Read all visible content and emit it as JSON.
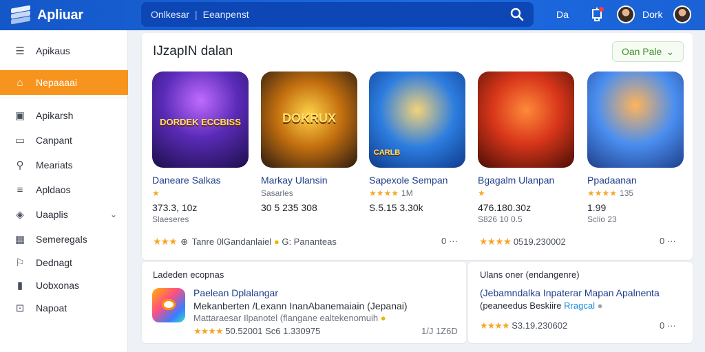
{
  "app": {
    "name": "Apliuar"
  },
  "search": {
    "crumb1": "Onlkesar",
    "crumb2": "Eeanpenst"
  },
  "topbar": {
    "link1": "Da",
    "user": "Dork"
  },
  "sidebar": {
    "items": [
      {
        "label": "Apikaus",
        "icon": "menu-icon"
      },
      {
        "label": "Nepaaaai",
        "icon": "home-icon",
        "active": true
      },
      {
        "label": "Apikarsh",
        "icon": "store-icon"
      },
      {
        "label": "Canpant",
        "icon": "monitor-icon"
      },
      {
        "label": "Meariats",
        "icon": "search-icon"
      },
      {
        "label": "Apldaos",
        "icon": "list-icon"
      },
      {
        "label": "Uaaplis",
        "icon": "tag-icon",
        "expandable": true
      },
      {
        "label": "Semeregals",
        "icon": "calendar-icon"
      },
      {
        "label": "Dednagt",
        "icon": "user-icon"
      },
      {
        "label": "Uobxonas",
        "icon": "chart-icon"
      },
      {
        "label": "Napoat",
        "icon": "box-icon"
      }
    ]
  },
  "main": {
    "title": "IJzapIN dalan",
    "filter_label": "Oan Pale",
    "games": [
      {
        "name": "Daneare Salkas",
        "thumb_title": "DORDEK ECCBISS",
        "stars": "★",
        "count": "",
        "price": "373.3, 10z",
        "sub": "Slaeseres",
        "c1": "#5a2bb8",
        "c2": "#2a1a6e"
      },
      {
        "name": "Markay Ulansin",
        "thumb_title": "DOKRUX",
        "stars": "",
        "count": "Sasarles",
        "price": "30 5 235 308",
        "sub": "",
        "c1": "#d9a11f",
        "c2": "#3a2a1a"
      },
      {
        "name": "Sapexole Sempan",
        "thumb_title": "CARLB",
        "stars": "★★★★",
        "count": "1M",
        "price": "S.5.15 3.30k",
        "sub": "",
        "c1": "#2c7de0",
        "c2": "#f0c040"
      },
      {
        "name": "Bgagalm Ulanpan",
        "thumb_title": "",
        "stars": "★",
        "count": "",
        "price": "476.180.30z",
        "sub": "S826 10 0.5",
        "c1": "#e84a1a",
        "c2": "#6b1a0a"
      },
      {
        "name": "Ppadaanan",
        "thumb_title": "",
        "stars": "★★★★",
        "count": "135",
        "price": "1.99",
        "sub": "Sclio 23",
        "c1": "#4a8ef0",
        "c2": "#f08a3a"
      }
    ],
    "row_footer_left": "Tanre 0lGandanlaiel",
    "row_footer_mid": "G: Pananteas",
    "row_footer_right": "0519.230002",
    "more_label": "0 ···"
  },
  "bottom_left": {
    "title": "Ladeden ecopnas",
    "app_name": "Paelean Dplalangar",
    "line1": "Mekanberten /Lexann InanAbanemaiain (Jepanai)",
    "line2": "Mattaraesar Ilpanotel (flangane ealtekenomuih",
    "rating_text": "50.52001 Sc6 1.330975",
    "side_value": "1/J 1Z6D"
  },
  "bottom_right": {
    "title": "Ulans oner (endangenre)",
    "link": "(Jebamndalka Inpaterar Mapan Apalnenta",
    "line2": "(peaneedus Beskiire",
    "tag": "Rragcal",
    "rating_text": "S3.19.230602",
    "more_label": "0 ···"
  }
}
